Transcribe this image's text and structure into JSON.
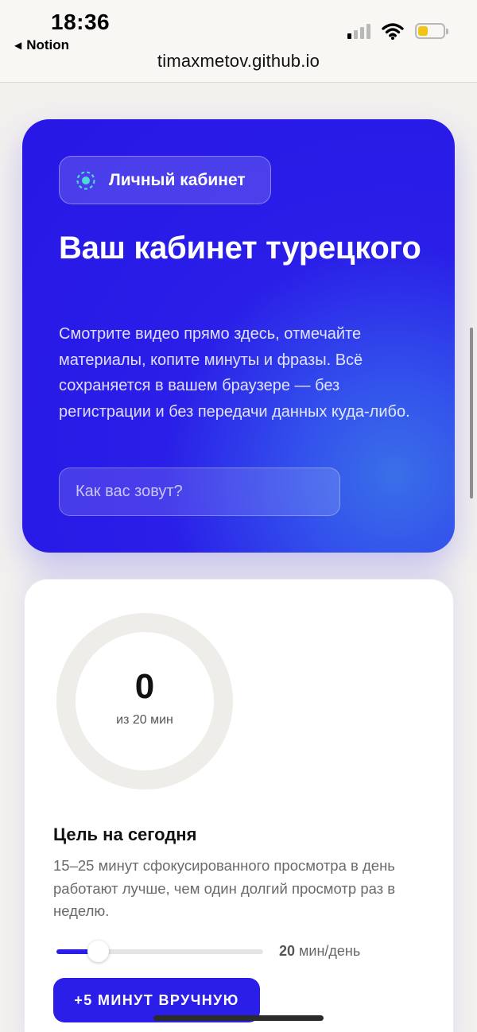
{
  "status": {
    "time": "18:36",
    "back_app": "Notion",
    "url": "timaxmetov.github.io",
    "battery_color": "#f3c318"
  },
  "hero": {
    "badge_label": "Личный кабинет",
    "badge_icon": "dashed-circle-icon",
    "title": "Ваш кабинет турецкого",
    "description": "Смотрите видео прямо здесь, отмечайте материалы, копите минуты и фразы. Всё сохраняется в вашем браузере — без регистрации и без передачи данных куда-либо.",
    "name_placeholder": "Как вас зовут?",
    "accent": "#2a1ee8"
  },
  "progress": {
    "minutes_value": "0",
    "minutes_sub": "из 20 мин",
    "progress_fraction": 0,
    "goal_title": "Цель на сегодня",
    "goal_text": "15–25 минут сфокусированного просмотра в день работают лучше, чем один долгий просмотр раз в неделю.",
    "slider_value": "20",
    "slider_unit": "мин/день",
    "slider_fraction": 0.2,
    "add_button": "+5 МИНУТ ВРУЧНУЮ"
  }
}
